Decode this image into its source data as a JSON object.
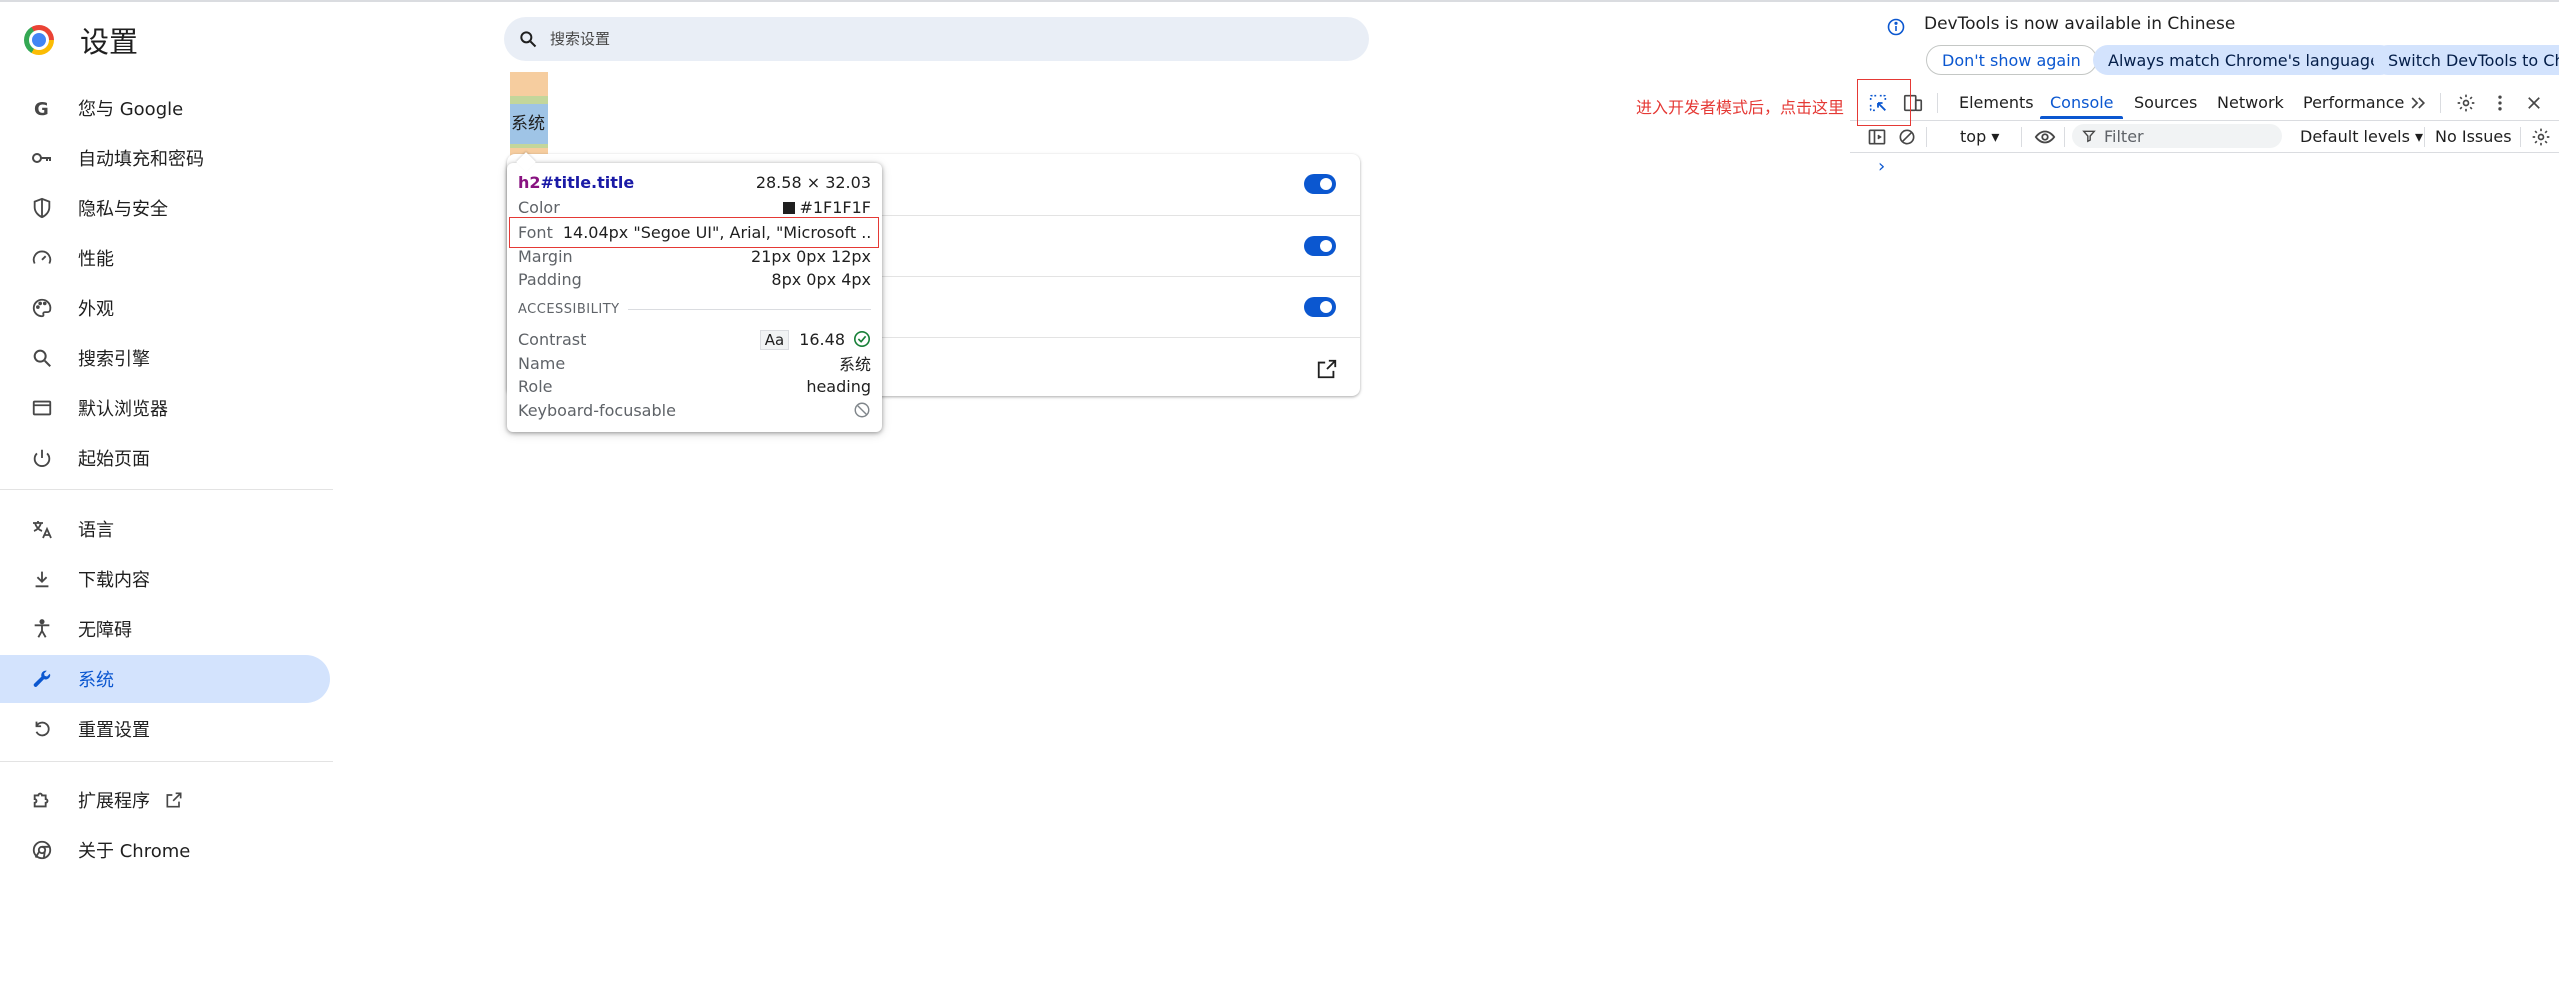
{
  "settings": {
    "title": "设置",
    "search_placeholder": "搜索设置",
    "sidebar": [
      {
        "label": "您与 Google",
        "icon": "google-icon"
      },
      {
        "label": "自动填充和密码",
        "icon": "key-icon"
      },
      {
        "label": "隐私与安全",
        "icon": "shield-icon"
      },
      {
        "label": "性能",
        "icon": "speedometer-icon"
      },
      {
        "label": "外观",
        "icon": "palette-icon"
      },
      {
        "label": "搜索引擎",
        "icon": "search-icon"
      },
      {
        "label": "默认浏览器",
        "icon": "browser-window-icon"
      },
      {
        "label": "起始页面",
        "icon": "power-icon"
      },
      {
        "label": "语言",
        "icon": "translate-icon"
      },
      {
        "label": "下载内容",
        "icon": "download-icon"
      },
      {
        "label": "无障碍",
        "icon": "accessibility-icon"
      },
      {
        "label": "系统",
        "icon": "wrench-icon",
        "active": true
      },
      {
        "label": "重置设置",
        "icon": "reset-icon"
      },
      {
        "label": "扩展程序",
        "icon": "puzzle-icon",
        "external": true
      },
      {
        "label": "关于 Chrome",
        "icon": "chrome-icon"
      }
    ],
    "highlighted_heading": "系统",
    "toggles_on": [
      true,
      true,
      true
    ]
  },
  "tooltip": {
    "tag": "h2",
    "selector": "#title.title",
    "dimensions": "28.58 × 32.03",
    "rows": [
      {
        "label": "Color",
        "value": "#1F1F1F"
      },
      {
        "label": "Font",
        "value": "14.04px \"Segoe UI\", Arial, \"Microsoft ..."
      },
      {
        "label": "Margin",
        "value": "21px 0px 12px"
      },
      {
        "label": "Padding",
        "value": "8px 0px 4px"
      }
    ],
    "accessibility_header": "ACCESSIBILITY",
    "contrast_label": "Contrast",
    "contrast_aa": "Aa",
    "contrast_value": "16.48",
    "name_label": "Name",
    "name_value": "系统",
    "role_label": "Role",
    "role_value": "heading",
    "keyboard_label": "Keyboard-focusable"
  },
  "devtools": {
    "banner_text": "DevTools is now available in Chinese",
    "banner_buttons": [
      "Don't show again",
      "Always match Chrome's language",
      "Switch DevTools to Chin"
    ],
    "annotation": "进入开发者模式后，点击这里",
    "tabs": [
      "Elements",
      "Console",
      "Sources",
      "Network",
      "Performance"
    ],
    "active_tab": "Console",
    "context": "top",
    "filter_placeholder": "Filter",
    "levels": "Default levels",
    "issues": "No Issues",
    "colors": {
      "accent": "#0b57d0",
      "annotation": "#e53935"
    }
  }
}
